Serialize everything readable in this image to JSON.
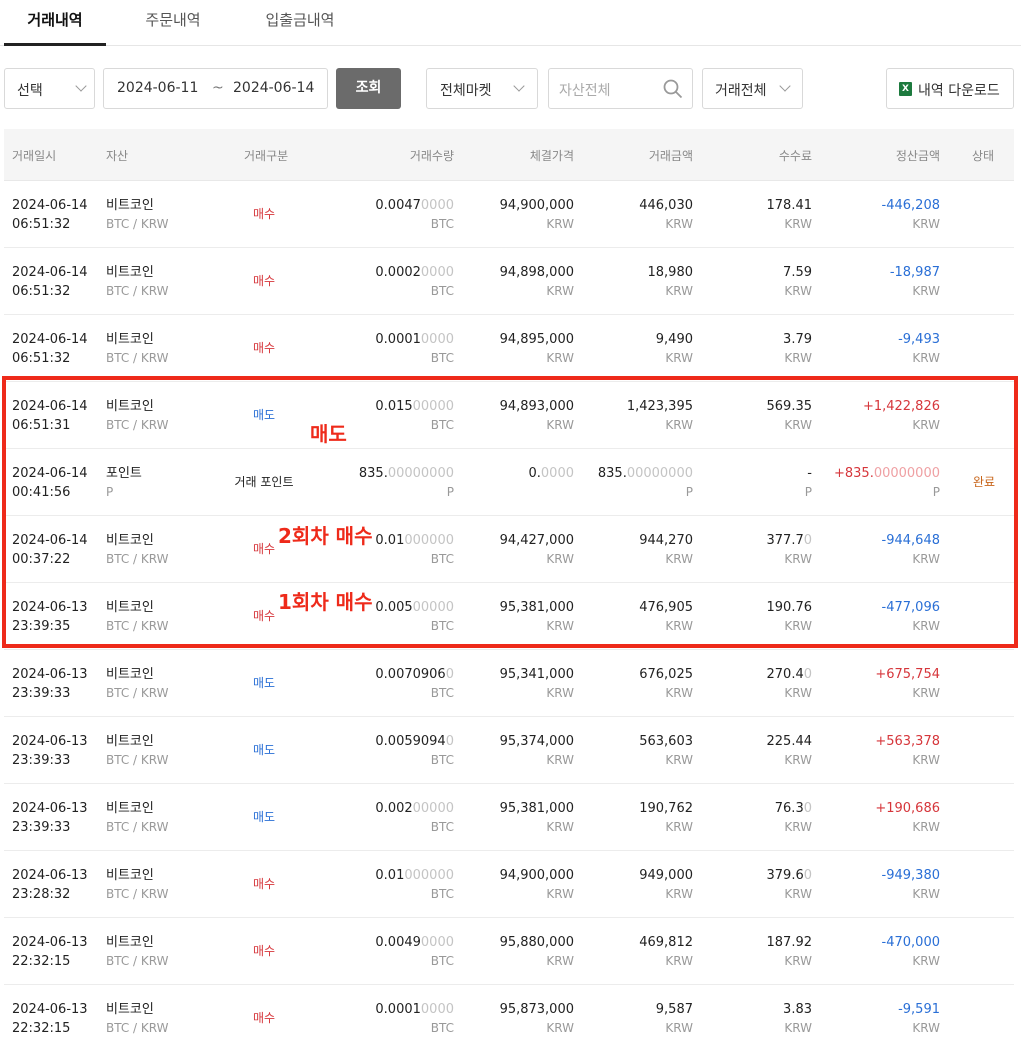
{
  "tabs": [
    "거래내역",
    "주문내역",
    "입출금내역"
  ],
  "filters": {
    "period_select": "선택",
    "date_from": "2024-06-11",
    "date_sep": "~",
    "date_to": "2024-06-14",
    "search_button": "조회",
    "market_select": "전체마켓",
    "asset_placeholder": "자산전체",
    "trade_type_select": "거래전체",
    "download_button": "내역 다운로드",
    "download_icon": "X"
  },
  "columns": [
    "거래일시",
    "자산",
    "거래구분",
    "거래수량",
    "체결가격",
    "거래금액",
    "수수료",
    "정산금액",
    "상태"
  ],
  "rows": [
    {
      "date": "2024-06-14",
      "time": "06:51:32",
      "asset": "비트코인",
      "pair": "BTC / KRW",
      "side": "매수",
      "qty": "0.0047",
      "qty_rest": "0000",
      "qty_unit": "BTC",
      "price": "94,900,000",
      "price_rest": "",
      "price_unit": "KRW",
      "amount": "446,030",
      "amount_rest": "",
      "amount_unit": "KRW",
      "fee": "178.41",
      "fee_rest": "",
      "fee_unit": "KRW",
      "settle": "-446,208",
      "settle_rest": "",
      "settle_unit": "KRW",
      "status": ""
    },
    {
      "date": "2024-06-14",
      "time": "06:51:32",
      "asset": "비트코인",
      "pair": "BTC / KRW",
      "side": "매수",
      "qty": "0.0002",
      "qty_rest": "0000",
      "qty_unit": "BTC",
      "price": "94,898,000",
      "price_rest": "",
      "price_unit": "KRW",
      "amount": "18,980",
      "amount_rest": "",
      "amount_unit": "KRW",
      "fee": "7.59",
      "fee_rest": "",
      "fee_unit": "KRW",
      "settle": "-18,987",
      "settle_rest": "",
      "settle_unit": "KRW",
      "status": ""
    },
    {
      "date": "2024-06-14",
      "time": "06:51:32",
      "asset": "비트코인",
      "pair": "BTC / KRW",
      "side": "매수",
      "qty": "0.0001",
      "qty_rest": "0000",
      "qty_unit": "BTC",
      "price": "94,895,000",
      "price_rest": "",
      "price_unit": "KRW",
      "amount": "9,490",
      "amount_rest": "",
      "amount_unit": "KRW",
      "fee": "3.79",
      "fee_rest": "",
      "fee_unit": "KRW",
      "settle": "-9,493",
      "settle_rest": "",
      "settle_unit": "KRW",
      "status": ""
    },
    {
      "date": "2024-06-14",
      "time": "06:51:31",
      "asset": "비트코인",
      "pair": "BTC / KRW",
      "side": "매도",
      "qty": "0.015",
      "qty_rest": "00000",
      "qty_unit": "BTC",
      "price": "94,893,000",
      "price_rest": "",
      "price_unit": "KRW",
      "amount": "1,423,395",
      "amount_rest": "",
      "amount_unit": "KRW",
      "fee": "569.35",
      "fee_rest": "",
      "fee_unit": "KRW",
      "settle": "+1,422,826",
      "settle_rest": "",
      "settle_unit": "KRW",
      "status": ""
    },
    {
      "date": "2024-06-14",
      "time": "00:41:56",
      "asset": "포인트",
      "pair": "P",
      "side": "거래 포인트",
      "qty": "835.",
      "qty_rest": "00000000",
      "qty_unit": "P",
      "price": "0.",
      "price_rest": "0000",
      "price_unit": "",
      "amount": "835.",
      "amount_rest": "00000000",
      "amount_unit": "P",
      "fee": "-",
      "fee_rest": "",
      "fee_unit": "P",
      "settle": "+835.",
      "settle_rest": "00000000",
      "settle_unit": "P",
      "status": "완료"
    },
    {
      "date": "2024-06-14",
      "time": "00:37:22",
      "asset": "비트코인",
      "pair": "BTC / KRW",
      "side": "매수",
      "qty": "0.01",
      "qty_rest": "000000",
      "qty_unit": "BTC",
      "price": "94,427,000",
      "price_rest": "",
      "price_unit": "KRW",
      "amount": "944,270",
      "amount_rest": "",
      "amount_unit": "KRW",
      "fee": "377.7",
      "fee_rest": "0",
      "fee_unit": "KRW",
      "settle": "-944,648",
      "settle_rest": "",
      "settle_unit": "KRW",
      "status": ""
    },
    {
      "date": "2024-06-13",
      "time": "23:39:35",
      "asset": "비트코인",
      "pair": "BTC / KRW",
      "side": "매수",
      "qty": "0.005",
      "qty_rest": "00000",
      "qty_unit": "BTC",
      "price": "95,381,000",
      "price_rest": "",
      "price_unit": "KRW",
      "amount": "476,905",
      "amount_rest": "",
      "amount_unit": "KRW",
      "fee": "190.76",
      "fee_rest": "",
      "fee_unit": "KRW",
      "settle": "-477,096",
      "settle_rest": "",
      "settle_unit": "KRW",
      "status": ""
    },
    {
      "date": "2024-06-13",
      "time": "23:39:33",
      "asset": "비트코인",
      "pair": "BTC / KRW",
      "side": "매도",
      "qty": "0.0070906",
      "qty_rest": "0",
      "qty_unit": "BTC",
      "price": "95,341,000",
      "price_rest": "",
      "price_unit": "KRW",
      "amount": "676,025",
      "amount_rest": "",
      "amount_unit": "KRW",
      "fee": "270.4",
      "fee_rest": "0",
      "fee_unit": "KRW",
      "settle": "+675,754",
      "settle_rest": "",
      "settle_unit": "KRW",
      "status": ""
    },
    {
      "date": "2024-06-13",
      "time": "23:39:33",
      "asset": "비트코인",
      "pair": "BTC / KRW",
      "side": "매도",
      "qty": "0.0059094",
      "qty_rest": "0",
      "qty_unit": "BTC",
      "price": "95,374,000",
      "price_rest": "",
      "price_unit": "KRW",
      "amount": "563,603",
      "amount_rest": "",
      "amount_unit": "KRW",
      "fee": "225.44",
      "fee_rest": "",
      "fee_unit": "KRW",
      "settle": "+563,378",
      "settle_rest": "",
      "settle_unit": "KRW",
      "status": ""
    },
    {
      "date": "2024-06-13",
      "time": "23:39:33",
      "asset": "비트코인",
      "pair": "BTC / KRW",
      "side": "매도",
      "qty": "0.002",
      "qty_rest": "00000",
      "qty_unit": "BTC",
      "price": "95,381,000",
      "price_rest": "",
      "price_unit": "KRW",
      "amount": "190,762",
      "amount_rest": "",
      "amount_unit": "KRW",
      "fee": "76.3",
      "fee_rest": "0",
      "fee_unit": "KRW",
      "settle": "+190,686",
      "settle_rest": "",
      "settle_unit": "KRW",
      "status": ""
    },
    {
      "date": "2024-06-13",
      "time": "23:28:32",
      "asset": "비트코인",
      "pair": "BTC / KRW",
      "side": "매수",
      "qty": "0.01",
      "qty_rest": "000000",
      "qty_unit": "BTC",
      "price": "94,900,000",
      "price_rest": "",
      "price_unit": "KRW",
      "amount": "949,000",
      "amount_rest": "",
      "amount_unit": "KRW",
      "fee": "379.6",
      "fee_rest": "0",
      "fee_unit": "KRW",
      "settle": "-949,380",
      "settle_rest": "",
      "settle_unit": "KRW",
      "status": ""
    },
    {
      "date": "2024-06-13",
      "time": "22:32:15",
      "asset": "비트코인",
      "pair": "BTC / KRW",
      "side": "매수",
      "qty": "0.0049",
      "qty_rest": "0000",
      "qty_unit": "BTC",
      "price": "95,880,000",
      "price_rest": "",
      "price_unit": "KRW",
      "amount": "469,812",
      "amount_rest": "",
      "amount_unit": "KRW",
      "fee": "187.92",
      "fee_rest": "",
      "fee_unit": "KRW",
      "settle": "-470,000",
      "settle_rest": "",
      "settle_unit": "KRW",
      "status": ""
    },
    {
      "date": "2024-06-13",
      "time": "22:32:15",
      "asset": "비트코인",
      "pair": "BTC / KRW",
      "side": "매수",
      "qty": "0.0001",
      "qty_rest": "0000",
      "qty_unit": "BTC",
      "price": "95,873,000",
      "price_rest": "",
      "price_unit": "KRW",
      "amount": "9,587",
      "amount_rest": "",
      "amount_unit": "KRW",
      "fee": "3.83",
      "fee_rest": "",
      "fee_unit": "KRW",
      "settle": "-9,591",
      "settle_rest": "",
      "settle_unit": "KRW",
      "status": ""
    }
  ],
  "annotations": {
    "sell_label": "매도",
    "buy2_label": "2회차 매수",
    "buy1_label": "1회차 매수"
  },
  "colors": {
    "buy": "#d6363b",
    "sell": "#2a6fd6",
    "highlight": "#ee2a1a",
    "status_done": "#c8651a"
  }
}
